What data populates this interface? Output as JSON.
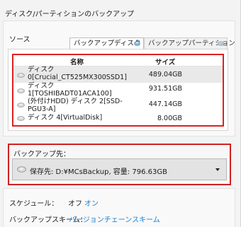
{
  "header": {
    "title": "ディスク/パーティションのバックアップ"
  },
  "source": {
    "label": "ソース",
    "tabs": [
      {
        "label": "バックアップディスク",
        "active": true,
        "icon": "disk-backup-icon"
      },
      {
        "label": "バックアップパーティション",
        "active": false,
        "icon": "partition-backup-icon"
      }
    ],
    "table": {
      "columns": [
        "名称",
        "サイズ"
      ],
      "rows": [
        {
          "line1": "ディスク",
          "line2": "0[Crucial_CT525MX300SSD1]",
          "line3": "",
          "size": "489.04GB",
          "selected": true
        },
        {
          "line1": "ディスク",
          "line2": "1[TOSHIBADT01ACA100]",
          "line3": "",
          "size": "931.51GB",
          "selected": false
        },
        {
          "line1": "(外付けHDD) ディスク 2[SSD-",
          "line2": "PGU3-A]",
          "line3": "",
          "size": "447.14GB",
          "selected": false
        },
        {
          "line1": "ディスク 4[VirtualDisk]",
          "line2": "",
          "line3": "",
          "size": "8.00GB",
          "selected": false
        }
      ]
    }
  },
  "destination": {
    "label": "バックアップ先：",
    "value": "保存先: D:¥MCsBackup, 容量: 796.63GB"
  },
  "schedule": {
    "label": "スケジュール：",
    "state": "オフ",
    "toggle": "オン"
  },
  "scheme": {
    "label": "バックアップスキーム：",
    "value": "バージョンチェーンスキーム"
  },
  "colors": {
    "highlight": "#e02020",
    "link": "#1a7fd6",
    "selected_row": "#e9e9e9"
  }
}
